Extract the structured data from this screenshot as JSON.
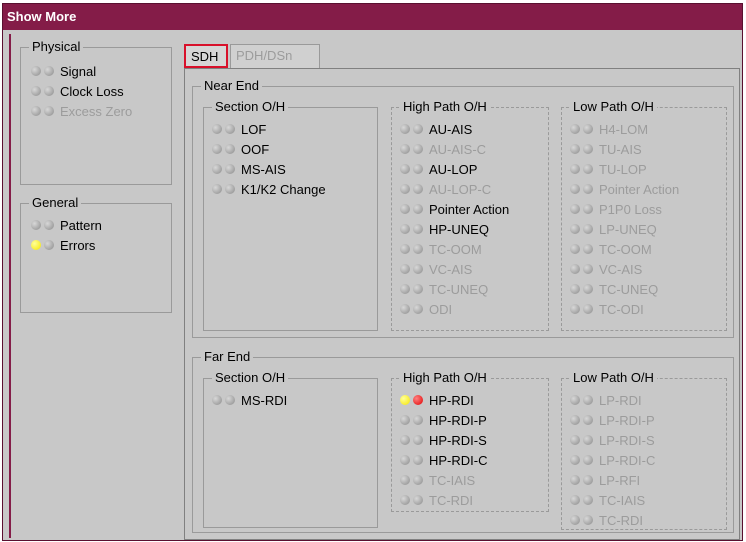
{
  "window": {
    "title": "Show More"
  },
  "physical": {
    "legend": "Physical",
    "items": [
      {
        "label": "Signal",
        "enabled": true,
        "leds": [
          "gray",
          "gray"
        ]
      },
      {
        "label": "Clock Loss",
        "enabled": true,
        "leds": [
          "gray",
          "gray"
        ]
      },
      {
        "label": "Excess Zero",
        "enabled": false,
        "leds": [
          "gray",
          "gray"
        ]
      }
    ]
  },
  "general": {
    "legend": "General",
    "items": [
      {
        "label": "Pattern",
        "enabled": true,
        "leds": [
          "gray",
          "gray"
        ]
      },
      {
        "label": "Errors",
        "enabled": true,
        "leds": [
          "yellow",
          "gray"
        ]
      }
    ]
  },
  "tabs": [
    {
      "label": "SDH",
      "active": true
    },
    {
      "label": "PDH/DSn",
      "active": false
    }
  ],
  "near_end": {
    "legend": "Near End",
    "section": {
      "legend": "Section O/H",
      "items": [
        {
          "label": "LOF",
          "enabled": true,
          "leds": [
            "gray",
            "gray"
          ]
        },
        {
          "label": "OOF",
          "enabled": true,
          "leds": [
            "gray",
            "gray"
          ]
        },
        {
          "label": "MS-AIS",
          "enabled": true,
          "leds": [
            "gray",
            "gray"
          ]
        },
        {
          "label": "K1/K2 Change",
          "enabled": true,
          "leds": [
            "gray",
            "gray"
          ]
        }
      ]
    },
    "high_path": {
      "legend": "High Path O/H",
      "items": [
        {
          "label": "AU-AIS",
          "enabled": true,
          "leds": [
            "gray",
            "gray"
          ]
        },
        {
          "label": "AU-AIS-C",
          "enabled": false,
          "leds": [
            "gray",
            "gray"
          ]
        },
        {
          "label": "AU-LOP",
          "enabled": true,
          "leds": [
            "gray",
            "gray"
          ]
        },
        {
          "label": "AU-LOP-C",
          "enabled": false,
          "leds": [
            "gray",
            "gray"
          ]
        },
        {
          "label": "Pointer Action",
          "enabled": true,
          "leds": [
            "gray",
            "gray"
          ]
        },
        {
          "label": "HP-UNEQ",
          "enabled": true,
          "leds": [
            "gray",
            "gray"
          ]
        },
        {
          "label": "TC-OOM",
          "enabled": false,
          "leds": [
            "gray",
            "gray"
          ]
        },
        {
          "label": "VC-AIS",
          "enabled": false,
          "leds": [
            "gray",
            "gray"
          ]
        },
        {
          "label": "TC-UNEQ",
          "enabled": false,
          "leds": [
            "gray",
            "gray"
          ]
        },
        {
          "label": "ODI",
          "enabled": false,
          "leds": [
            "gray",
            "gray"
          ]
        }
      ]
    },
    "low_path": {
      "legend": "Low Path O/H",
      "items": [
        {
          "label": "H4-LOM",
          "enabled": false,
          "leds": [
            "gray",
            "gray"
          ]
        },
        {
          "label": "TU-AIS",
          "enabled": false,
          "leds": [
            "gray",
            "gray"
          ]
        },
        {
          "label": "TU-LOP",
          "enabled": false,
          "leds": [
            "gray",
            "gray"
          ]
        },
        {
          "label": "Pointer Action",
          "enabled": false,
          "leds": [
            "gray",
            "gray"
          ]
        },
        {
          "label": "P1P0 Loss",
          "enabled": false,
          "leds": [
            "gray",
            "gray"
          ]
        },
        {
          "label": "LP-UNEQ",
          "enabled": false,
          "leds": [
            "gray",
            "gray"
          ]
        },
        {
          "label": "TC-OOM",
          "enabled": false,
          "leds": [
            "gray",
            "gray"
          ]
        },
        {
          "label": "VC-AIS",
          "enabled": false,
          "leds": [
            "gray",
            "gray"
          ]
        },
        {
          "label": "TC-UNEQ",
          "enabled": false,
          "leds": [
            "gray",
            "gray"
          ]
        },
        {
          "label": "TC-ODI",
          "enabled": false,
          "leds": [
            "gray",
            "gray"
          ]
        }
      ]
    }
  },
  "far_end": {
    "legend": "Far End",
    "section": {
      "legend": "Section O/H",
      "items": [
        {
          "label": "MS-RDI",
          "enabled": true,
          "leds": [
            "gray",
            "gray"
          ]
        }
      ]
    },
    "high_path": {
      "legend": "High Path O/H",
      "items": [
        {
          "label": "HP-RDI",
          "enabled": true,
          "leds": [
            "yellow",
            "red"
          ]
        },
        {
          "label": "HP-RDI-P",
          "enabled": true,
          "leds": [
            "gray",
            "gray"
          ]
        },
        {
          "label": "HP-RDI-S",
          "enabled": true,
          "leds": [
            "gray",
            "gray"
          ]
        },
        {
          "label": "HP-RDI-C",
          "enabled": true,
          "leds": [
            "gray",
            "gray"
          ]
        },
        {
          "label": "TC-IAIS",
          "enabled": false,
          "leds": [
            "gray",
            "gray"
          ]
        },
        {
          "label": "TC-RDI",
          "enabled": false,
          "leds": [
            "gray",
            "gray"
          ]
        }
      ]
    },
    "low_path": {
      "legend": "Low Path O/H",
      "items": [
        {
          "label": "LP-RDI",
          "enabled": false,
          "leds": [
            "gray",
            "gray"
          ]
        },
        {
          "label": "LP-RDI-P",
          "enabled": false,
          "leds": [
            "gray",
            "gray"
          ]
        },
        {
          "label": "LP-RDI-S",
          "enabled": false,
          "leds": [
            "gray",
            "gray"
          ]
        },
        {
          "label": "LP-RDI-C",
          "enabled": false,
          "leds": [
            "gray",
            "gray"
          ]
        },
        {
          "label": "LP-RFI",
          "enabled": false,
          "leds": [
            "gray",
            "gray"
          ]
        },
        {
          "label": "TC-IAIS",
          "enabled": false,
          "leds": [
            "gray",
            "gray"
          ]
        },
        {
          "label": "TC-RDI",
          "enabled": false,
          "leds": [
            "gray",
            "gray"
          ]
        }
      ]
    }
  },
  "colors": {
    "title_bar": "#841c48",
    "panel_bg": "#c8c8c8",
    "active_tab_border": "#d8102a",
    "disabled_text": "#9c9c9c",
    "led_yellow": "#f5e600",
    "led_red": "#e00000",
    "led_gray": "#8a8a8a"
  }
}
